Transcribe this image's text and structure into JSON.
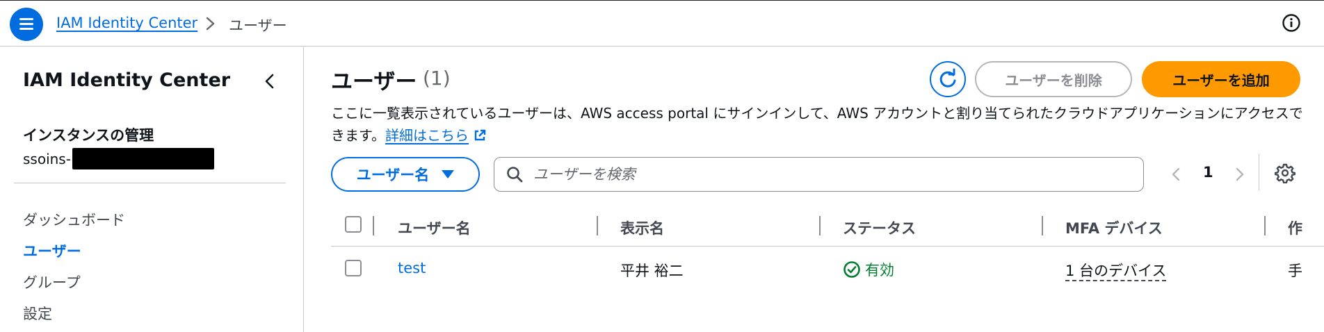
{
  "header": {
    "menu_icon": "hamburger-icon",
    "breadcrumb_root": "IAM Identity Center",
    "breadcrumb_current": "ユーザー",
    "info_icon": "info-icon",
    "accent_color": "#006ce0"
  },
  "sidebar": {
    "title": "IAM Identity Center",
    "instance_heading": "インスタンスの管理",
    "instance_prefix": "ssoins-",
    "items": [
      {
        "label": "ダッシュボード",
        "active": false
      },
      {
        "label": "ユーザー",
        "active": true
      },
      {
        "label": "グループ",
        "active": false
      },
      {
        "label": "設定",
        "active": false
      }
    ]
  },
  "main": {
    "title": "ユーザー",
    "count": "(1)",
    "delete_label": "ユーザーを削除",
    "add_label": "ユーザーを追加",
    "add_color": "#ff9900",
    "description": "ここに一覧表示されているユーザーは、AWS access portal にサインインして、AWS アカウントと割り当てられたクラウドアプリケーションにアクセスできます。",
    "description_link": "詳細はこちら",
    "filter_label": "ユーザー名",
    "search_placeholder": "ユーザーを検索",
    "page_number": "1"
  },
  "table": {
    "columns": [
      "ユーザー名",
      "表示名",
      "ステータス",
      "MFA デバイス",
      "作"
    ],
    "rows": [
      {
        "username": "test",
        "display_name": "平井 裕二",
        "status": "有効",
        "mfa": "1 台のデバイス",
        "created": "手"
      }
    ],
    "status_color": "#00802f"
  }
}
